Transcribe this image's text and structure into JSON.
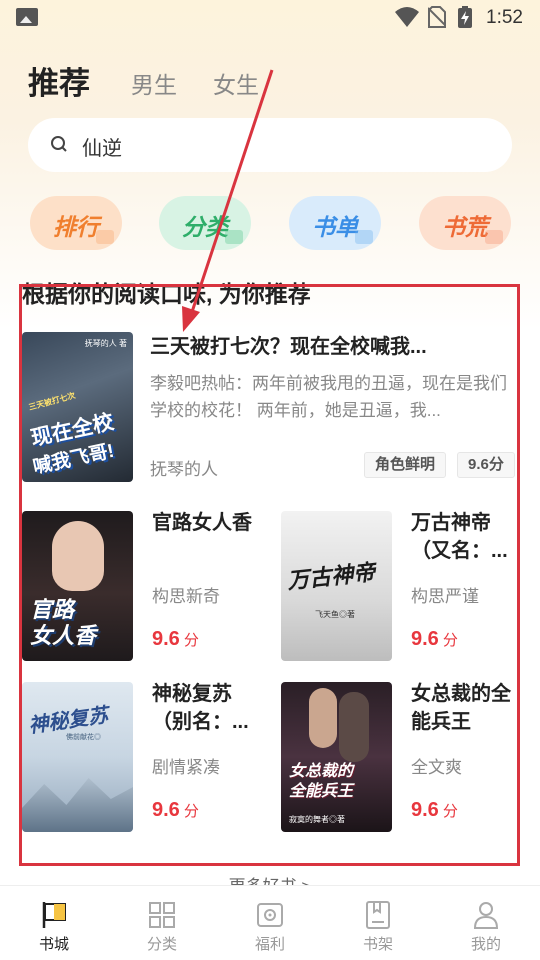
{
  "status_bar": {
    "time": "1:52"
  },
  "header": {
    "tabs": [
      {
        "label": "推荐"
      },
      {
        "label": "男生"
      },
      {
        "label": "女生"
      }
    ]
  },
  "search": {
    "value": "仙逆"
  },
  "quick_actions": [
    {
      "label": "排行"
    },
    {
      "label": "分类"
    },
    {
      "label": "书单"
    },
    {
      "label": "书荒"
    }
  ],
  "section": {
    "title": "根据你的阅读口味, 为你推荐",
    "featured": {
      "title": "三天被打七次？现在全校喊我...",
      "description": "李毅吧热帖：两年前被我甩的丑逼，现在是我们学校的校花！ 两年前，她是丑逼，我...",
      "author": "抚琴的人",
      "tag": "角色鲜明",
      "score": "9.6分",
      "cover_text_1": "现在全校",
      "cover_text_2": "喊我飞哥!",
      "cover_top": "抚琴的人 著",
      "cover_badge": "三天被打七次"
    },
    "books": [
      {
        "title": "官路女人香",
        "tag": "构思新奇",
        "score": "9.6",
        "unit": "分",
        "cover_text": "官路\n女人香"
      },
      {
        "title": "万古神帝（又名：...",
        "tag": "构思严谨",
        "score": "9.6",
        "unit": "分",
        "cover_text": "万古神帝",
        "cover_sub": "飞天鱼◎著"
      },
      {
        "title": "神秘复苏（别名：...",
        "tag": "剧情紧凑",
        "score": "9.6",
        "unit": "分",
        "cover_text": "神秘复苏",
        "cover_sub": "佛前献花◎"
      },
      {
        "title": "女总裁的全能兵王",
        "tag": "全文爽",
        "score": "9.6",
        "unit": "分",
        "cover_text": "女总裁的\n全能兵王",
        "cover_sub": "寂寞的舞者◎著"
      }
    ],
    "more": "更多好书 >"
  },
  "bottom_nav": [
    {
      "label": "书城",
      "icon": "flag-icon"
    },
    {
      "label": "分类",
      "icon": "grid-icon"
    },
    {
      "label": "福利",
      "icon": "gift-icon"
    },
    {
      "label": "书架",
      "icon": "bookshelf-icon"
    },
    {
      "label": "我的",
      "icon": "person-icon"
    }
  ],
  "colors": {
    "accent_red": "#e8373e",
    "highlight_box": "#d9343f"
  }
}
